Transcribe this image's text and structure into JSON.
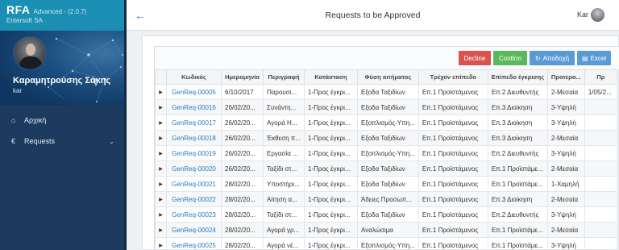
{
  "app": {
    "name": "RFA",
    "version": "Advanced - (2.0.7)",
    "company": "Entersoft SA"
  },
  "user": {
    "full_name": "Καραμητρούσης Σάκης",
    "short": "kar"
  },
  "sidebar": {
    "items": [
      {
        "icon": "home-icon",
        "label": "Αρχική"
      },
      {
        "icon": "euro-icon",
        "label": "Requests",
        "has_children": true
      }
    ]
  },
  "header": {
    "title": "Requests to be Approved",
    "user": "Kar"
  },
  "toolbar": {
    "decline": "Decline",
    "confirm": "Confirm",
    "approve": "Αποδοχή",
    "excel": "Excel"
  },
  "table": {
    "columns": [
      "Κωδικός",
      "Ημερομηνία",
      "Περιγραφή",
      "Κατάσταση",
      "Φύση αιτήματος",
      "Τρέχον επίπεδο",
      "Επίπεδο έγκρισης",
      "Προτερα...",
      "Πρ"
    ],
    "rows": [
      [
        "GenReq-00005",
        "6/10/2017",
        "Παρουσι...",
        "1-Προς έγκρι...",
        "Εξοδα Ταξιδίων",
        "Επ.1 Προϊστάμενος",
        "Επ.2 Διευθυντής",
        "2-Μεσαία",
        "1/05/2..."
      ],
      [
        "GenReq-00016",
        "26/02/20...",
        "Συνάντη...",
        "1-Προς έγκρι...",
        "Εξοδα Ταξιδίων",
        "Επ.1 Προϊστάμενος",
        "Επ.3 Διοίκηση",
        "3-Υψηλή",
        ""
      ],
      [
        "GenReq-00017",
        "26/02/20...",
        "Αγορά Η...",
        "1-Προς έγκρι...",
        "Εξοπλισμός-Υπη...",
        "Επ.1 Προϊστάμενος",
        "Επ.3 Διοίκηση",
        "3-Υψηλή",
        ""
      ],
      [
        "GenReq-00018",
        "26/02/20...",
        "Έκθεση π...",
        "1-Προς έγκρι...",
        "Εξοδα Ταξιδίων",
        "Επ.1 Προϊστάμενος",
        "Επ.3 Διοίκηση",
        "2-Μεσαία",
        ""
      ],
      [
        "GenReq-00019",
        "26/02/20...",
        "Εργασία ...",
        "1-Προς έγκρι...",
        "Εξοπλισμός-Υπη...",
        "Επ.1 Προϊστάμενος",
        "Επ.2 Διευθυντής",
        "3-Υψηλή",
        ""
      ],
      [
        "GenReq-00020",
        "26/02/20...",
        "Ταξίδι στ...",
        "1-Προς έγκρι...",
        "Εξοδα Ταξιδίων",
        "Επ.1 Προϊστάμενος",
        "Επ.1 Προϊστάμε...",
        "2-Μεσαία",
        ""
      ],
      [
        "GenReq-00021",
        "28/02/20...",
        "Υποστήρι...",
        "1-Προς έγκρι...",
        "Εξοδα Ταξιδίων",
        "Επ.1 Προϊστάμενος",
        "Επ.1 Προϊστάμε...",
        "1-Χαμηλή",
        ""
      ],
      [
        "GenReq-00022",
        "28/02/20...",
        "Αίτηση α...",
        "1-Προς έγκρι...",
        "Άδειες Προσωπ...",
        "Επ.1 Προϊστάμενος",
        "Επ.3 Διοίκηση",
        "2-Μεσαία",
        ""
      ],
      [
        "GenReq-00023",
        "28/02/20...",
        "Ταξίδι στ...",
        "1-Προς έγκρι...",
        "Εξοδα Ταξιδίων",
        "Επ.1 Προϊστάμενος",
        "Επ.2 Διευθυντής",
        "3-Υψηλή",
        ""
      ],
      [
        "GenReq-00024",
        "28/02/20...",
        "Αγορά γρ...",
        "1-Προς έγκρι...",
        "Αναλώσιμα",
        "Επ.1 Προϊστάμενος",
        "Επ.1 Προϊστάμε...",
        "2-Μεσαία",
        ""
      ],
      [
        "GenReq-00025",
        "28/02/20...",
        "Αγορά νέ...",
        "1-Προς έγκρι...",
        "Εξοπλισμός-Υπη...",
        "Επ.1 Προϊστάμενος",
        "Επ.1 Προϊστάμε...",
        "3-Υψηλή",
        ""
      ]
    ]
  },
  "colors": {
    "sidebar": "#1d3b5e",
    "brand": "#1b8fb3",
    "link": "#2b7bc0",
    "decline": "#d9534f",
    "confirm": "#5cb85c",
    "action": "#5b9bd5"
  }
}
